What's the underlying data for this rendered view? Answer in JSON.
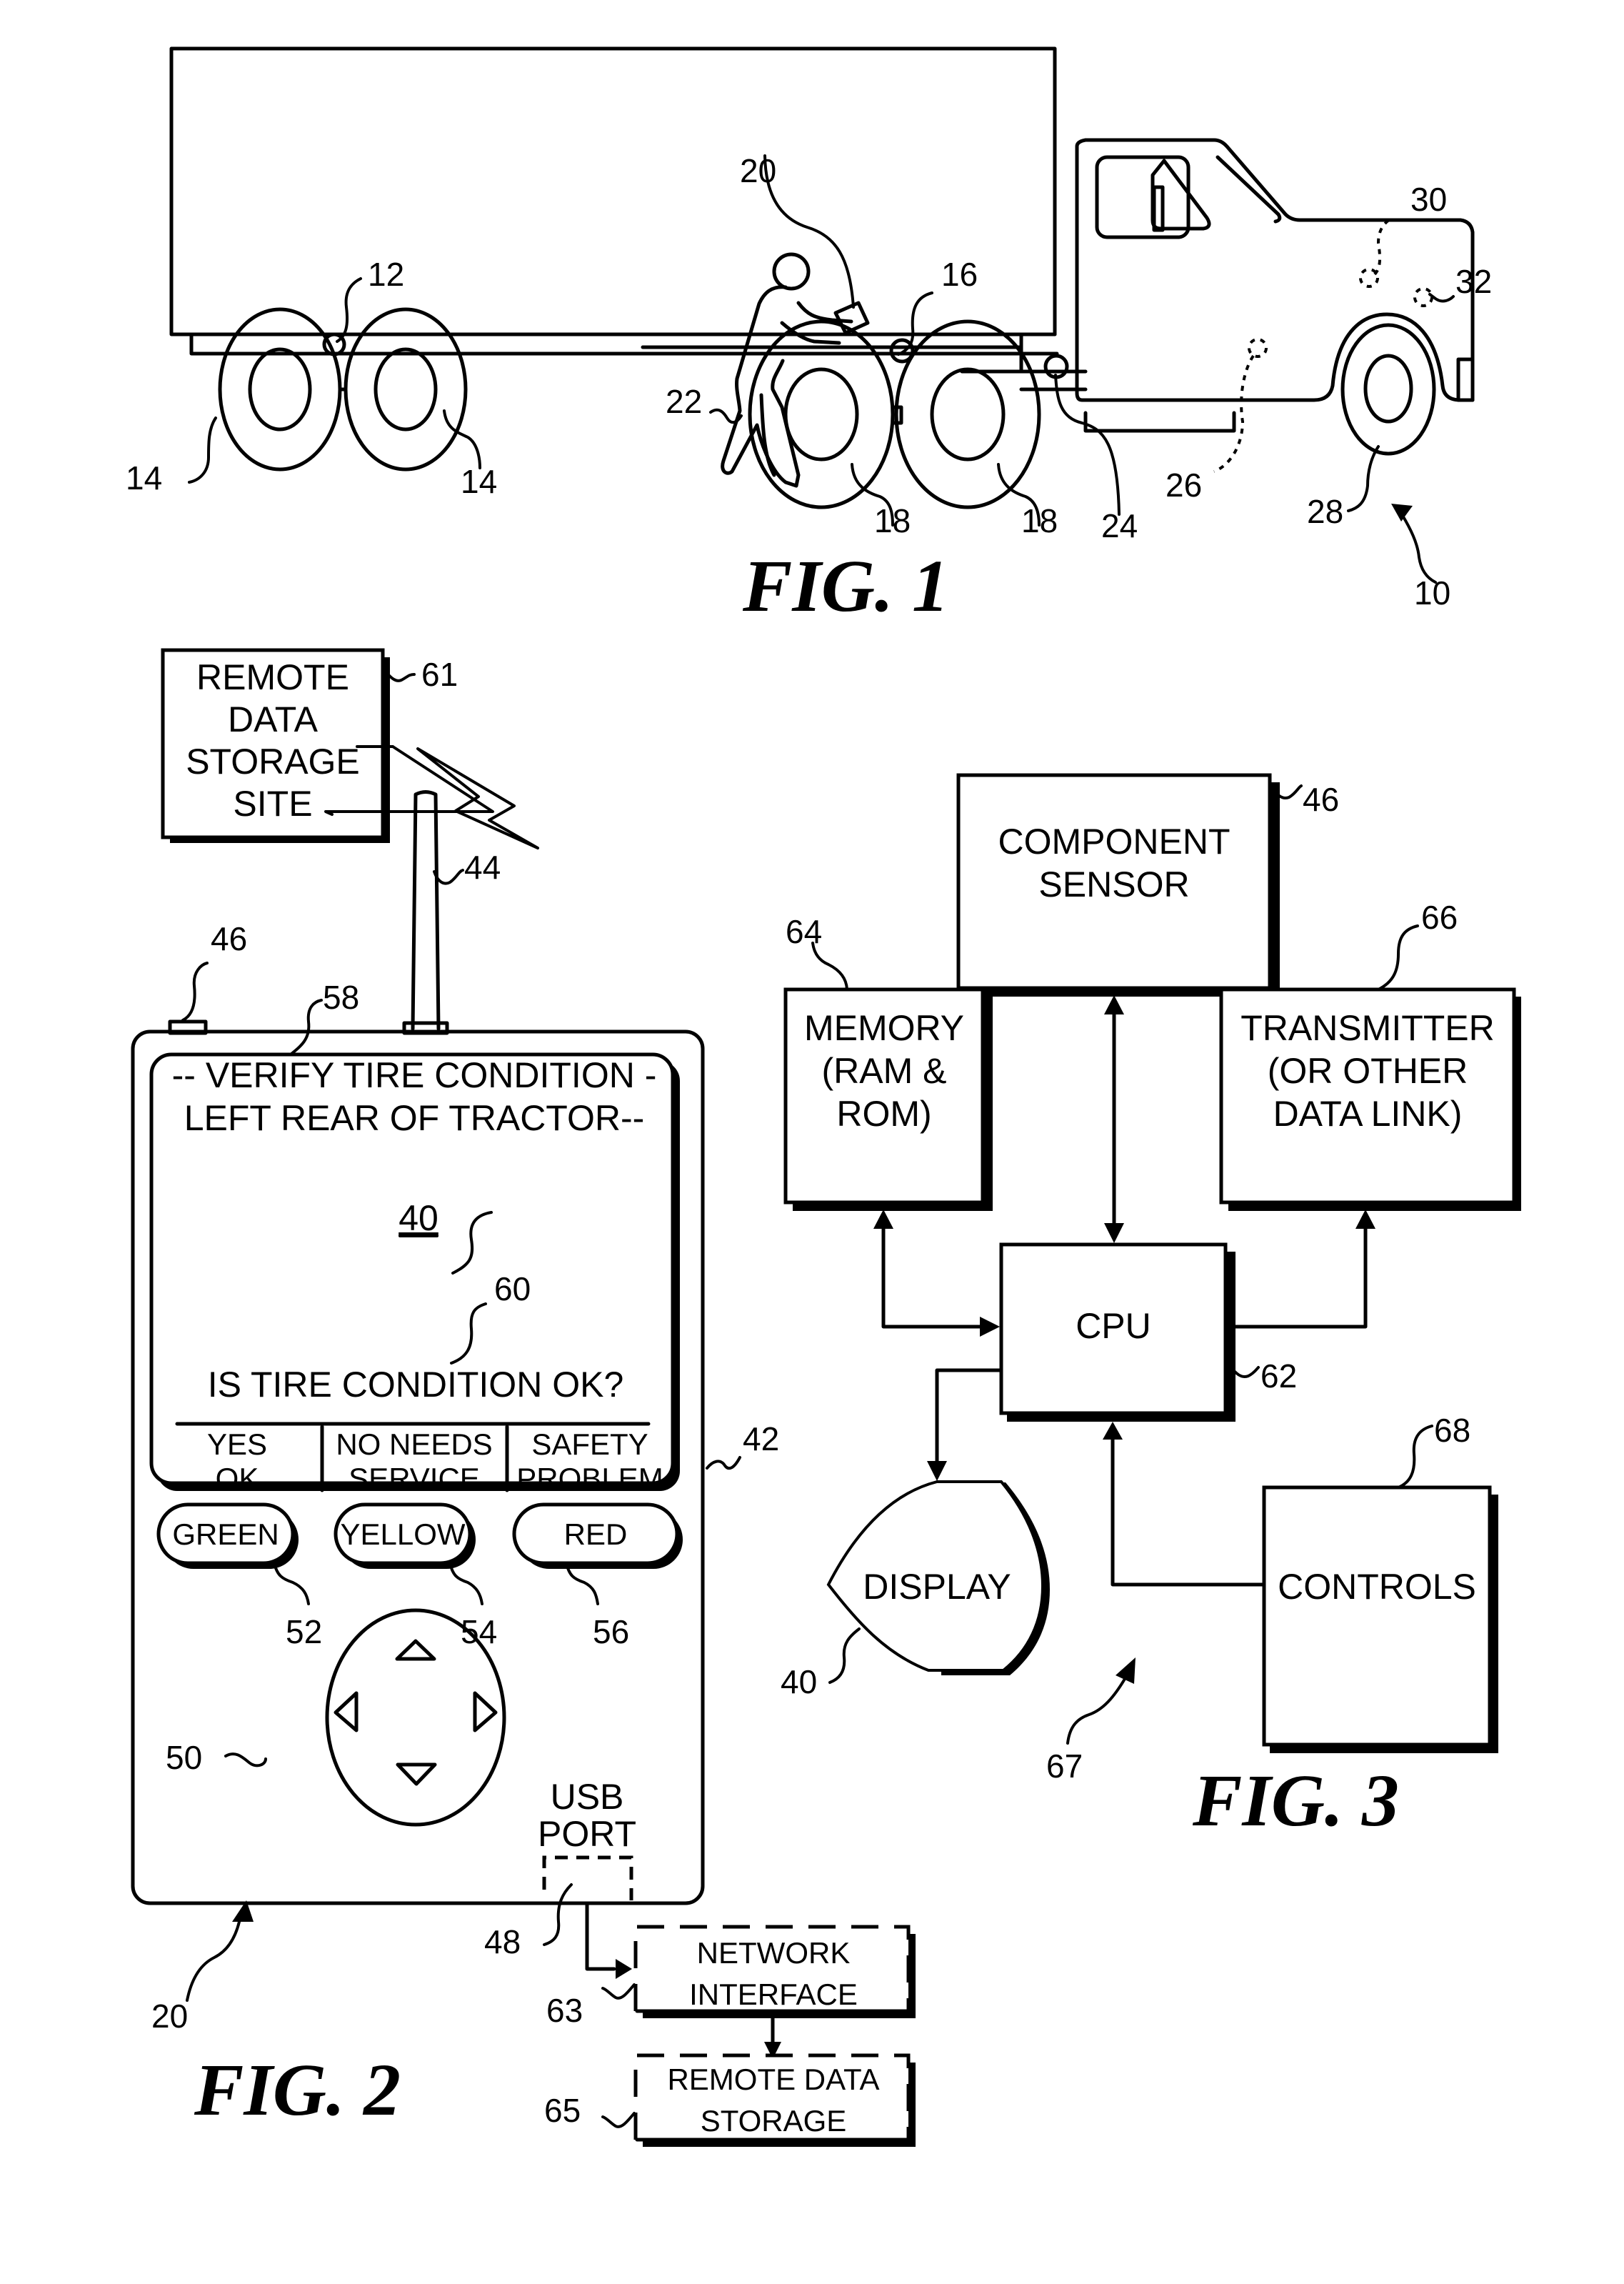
{
  "document": {
    "type": "patent drawing sheet",
    "figures": [
      "FIG. 1",
      "FIG. 2",
      "FIG. 3"
    ]
  },
  "fig1": {
    "caption": "FIG. 1",
    "refs": {
      "vehicle": "10",
      "trailer_sensor": "12",
      "trailer_wheels_left": "14",
      "trailer_wheels_right": "14",
      "tractor_sensor": "16",
      "drive_wheel_a": "18",
      "drive_wheel_b": "18",
      "handheld": "20",
      "operator": "22",
      "fifth_wheel": "24",
      "steer_sensor": "26",
      "steer_wheel": "28",
      "engine_sensor": "30",
      "front_sensor": "32"
    }
  },
  "fig2": {
    "caption": "FIG. 2",
    "remote_site": {
      "lines": [
        "REMOTE",
        "DATA",
        "STORAGE",
        "SITE"
      ],
      "ref": "61"
    },
    "antenna_ref": "44",
    "sensor_ref": "46",
    "screen_pointer_ref": "58",
    "device_ref": "42",
    "screen": {
      "header_line1": "-- VERIFY TIRE CONDITION -",
      "header_line2": "LEFT REAR OF TRACTOR--",
      "display_ref": "40",
      "question_ref": "60",
      "question": "IS TIRE CONDITION OK?",
      "options": [
        {
          "line1": "YES",
          "line2": "OK"
        },
        {
          "line1": "NO NEEDS",
          "line2": "SERVICE"
        },
        {
          "line1": "SAFETY",
          "line2": "PROBLEM"
        }
      ]
    },
    "buttons": [
      {
        "label": "GREEN",
        "ref": "52"
      },
      {
        "label": "YELLOW",
        "ref": "54"
      },
      {
        "label": "RED",
        "ref": "56"
      }
    ],
    "dpad_ref": "50",
    "usb": {
      "line1": "USB",
      "line2": "PORT",
      "ref": "48"
    },
    "device_outline_ref": "20",
    "network_interface": {
      "line1": "NETWORK",
      "line2": "INTERFACE",
      "ref": "63"
    },
    "remote_storage": {
      "line1": "REMOTE DATA",
      "line2": "STORAGE",
      "ref": "65"
    }
  },
  "fig3": {
    "caption": "FIG. 3",
    "system_ref": "67",
    "component_sensor": {
      "line1": "COMPONENT",
      "line2": "SENSOR",
      "ref": "46"
    },
    "memory": {
      "line1": "MEMORY",
      "line2": "(RAM &",
      "line3": "ROM)",
      "ref": "64"
    },
    "transmitter": {
      "line1": "TRANSMITTER",
      "line2": "(OR OTHER",
      "line3": "DATA LINK)",
      "ref": "66"
    },
    "cpu": {
      "label": "CPU",
      "ref": "62"
    },
    "display": {
      "label": "DISPLAY",
      "ref": "40"
    },
    "controls": {
      "label": "CONTROLS",
      "ref": "68"
    }
  }
}
